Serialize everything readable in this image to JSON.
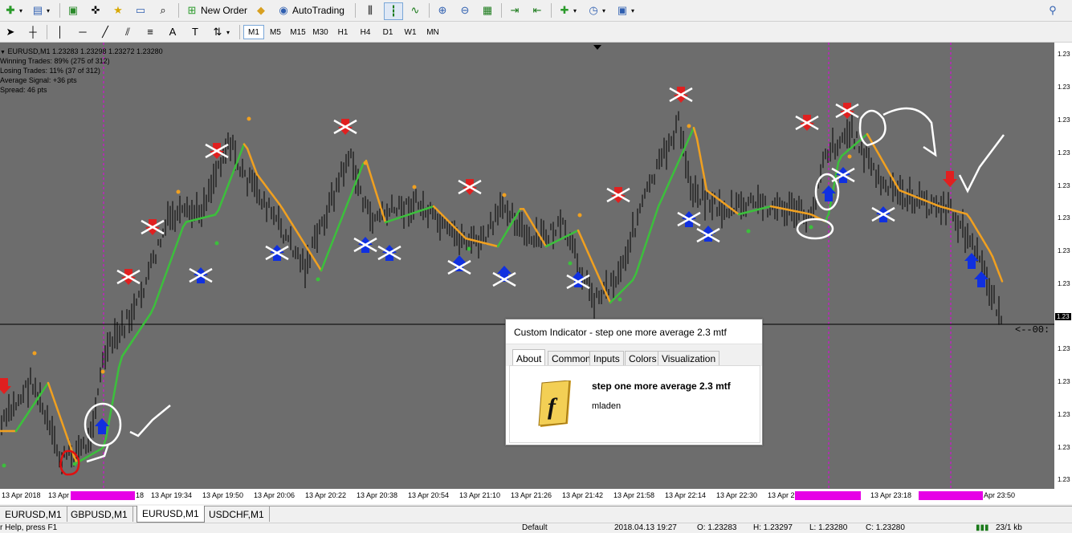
{
  "toolbar": {
    "new_order_label": "New Order",
    "autotrading_label": "AutoTrading"
  },
  "timeframes": [
    "M1",
    "M5",
    "M15",
    "M30",
    "H1",
    "H4",
    "D1",
    "W1",
    "MN"
  ],
  "chart": {
    "symbol_line": "EURUSD,M1  1.23283 1.23298 1.23272 1.23280",
    "stats": [
      "Winning Trades: 89% (275 of 312)",
      "Losing Trades: 11% (37 of 312)",
      "Average Signal: +36 pts",
      "Spread: 46 pts"
    ],
    "price_labels": [
      "1.23",
      "1.23",
      "1.23",
      "1.23",
      "1.23",
      "1.23",
      "1.23",
      "1.23",
      "1.23",
      "1.23",
      "1.23",
      "1.23",
      "1.23",
      "1.23"
    ],
    "current_price": "1.23",
    "countdown": "<--00:",
    "time_labels": [
      "13 Apr 2018",
      "13 Apr",
      "18",
      "13 Apr 19:34",
      "13 Apr 19:50",
      "13 Apr 20:06",
      "13 Apr 20:22",
      "13 Apr 20:38",
      "13 Apr 20:54",
      "13 Apr 21:10",
      "13 Apr 21:26",
      "13 Apr 21:42",
      "13 Apr 21:58",
      "13 Apr 22:14",
      "13 Apr 22:30",
      "13 Apr 2",
      "13 Apr 23:18",
      "Apr 23:50"
    ]
  },
  "tabs": [
    "EURUSD,M1",
    "GBPUSD,M1",
    "EURUSD,M1",
    "USDCHF,M1"
  ],
  "active_tab": 2,
  "status": {
    "help": "r Help, press F1",
    "profile": "Default",
    "datetime": "2018.04.13 19:27",
    "open": "O: 1.23283",
    "high": "H: 1.23297",
    "low": "L: 1.23280",
    "close": "C: 1.23280",
    "traffic": "23/1 kb"
  },
  "dialog": {
    "title": "Custom Indicator - step one more average 2.3 mtf",
    "tabs": [
      "About",
      "Common",
      "Inputs",
      "Colors",
      "Visualization"
    ],
    "indicator_name": "step one more average 2.3 mtf",
    "author": "mladen"
  },
  "colors": {
    "chart_bg": "#6d6d6d",
    "candle": "#000000",
    "rising_line": "#3cbf3c",
    "falling_line": "#f0a020",
    "sell_arrow": "#e02020",
    "buy_arrow": "#1030e0",
    "period_separator": "#e600e6",
    "annotation": "#ffffff"
  }
}
